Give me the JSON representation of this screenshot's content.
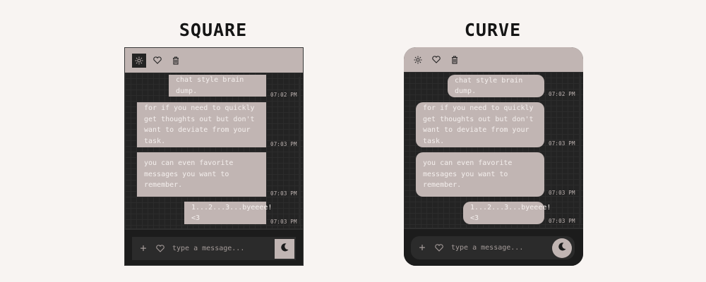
{
  "variants": [
    {
      "title": "SQUARE",
      "toolbar": [
        "settings-icon",
        "heart-icon",
        "trash-icon"
      ],
      "messages": [
        {
          "text": "chat style brain dump.",
          "time": "07:02 PM"
        },
        {
          "text": "for if you need to quickly get thoughts out but don't want to deviate from your task.",
          "time": "07:03 PM"
        },
        {
          "text": "you can even favorite messages you want to remember.",
          "time": "07:03 PM"
        },
        {
          "text": "1...2...3...byeeee! <3",
          "time": "07:03 PM"
        }
      ],
      "input": {
        "placeholder": "type a message...",
        "plus": "+"
      }
    },
    {
      "title": "CURVE",
      "toolbar": [
        "settings-icon",
        "heart-icon",
        "trash-icon"
      ],
      "messages": [
        {
          "text": "chat style brain dump.",
          "time": "07:02 PM"
        },
        {
          "text": "for if you need to quickly get thoughts out but don't want to deviate from your task.",
          "time": "07:03 PM"
        },
        {
          "text": "you can even favorite messages you want to remember.",
          "time": "07:03 PM"
        },
        {
          "text": "1...2...3...byeeee! <3",
          "time": "07:03 PM"
        }
      ],
      "input": {
        "placeholder": "type a message...",
        "plus": "+"
      }
    }
  ],
  "colors": {
    "background": "#f8f4f2",
    "accent": "#c1b5b3",
    "panel": "#232323",
    "bubble_text": "#f4efed"
  }
}
